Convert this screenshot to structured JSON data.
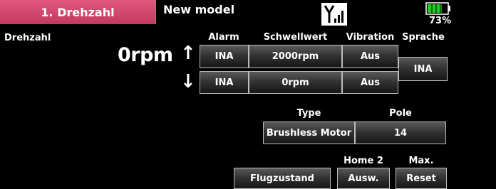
{
  "header": {
    "tab_label": "1. Drehzahl",
    "model_name": "New model",
    "battery_percent": "73%",
    "battery_level": 0.73
  },
  "section_label": "Drehzahl",
  "columns": {
    "alarm": "Alarm",
    "schwellwert": "Schwellwert",
    "vibration": "Vibration",
    "sprache": "Sprache"
  },
  "reading": {
    "rpm_value": "0rpm",
    "up_arrow": "↑",
    "down_arrow": "↓"
  },
  "rows": [
    {
      "alarm": "INA",
      "schwellwert": "2000rpm",
      "vibration": "Aus"
    },
    {
      "alarm": "INA",
      "schwellwert": "0rpm",
      "vibration": "Aus"
    }
  ],
  "sprache_value": "INA",
  "motor": {
    "type_label": "Type",
    "pole_label": "Pole",
    "type_value": "Brushless Motor",
    "pole_value": "14"
  },
  "bottom": {
    "home2_label": "Home 2",
    "max_label": "Max.",
    "flugzustand_button": "Flugzustand",
    "ausw_button": "Ausw.",
    "reset_button": "Reset"
  }
}
